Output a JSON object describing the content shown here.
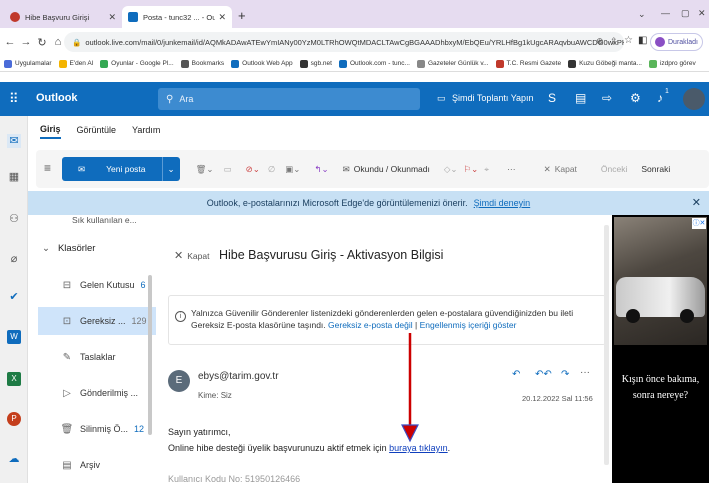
{
  "browser": {
    "tabs": [
      {
        "title": "Hibe Başvuru Girişi",
        "active": false,
        "favicon_color": "#c0392b"
      },
      {
        "title": "Posta - tunc32 ... - Outlook",
        "active": true,
        "favicon_color": "#0f6cbd"
      }
    ],
    "new_tab": "+",
    "window_controls": [
      "⌄",
      "—",
      "▢",
      "✕"
    ],
    "url": "outlook.live.com/mail/0/junkemail/id/AQMkADAwATEwYmIANy00YzM0LTRhOWQtMDACLTAwCgBGAAADhbxyM/EbQEu/YRLHfBg1kUgcARAqvbuAWCDG0wxPHO56hjAAAAgEi...",
    "profile_label": "Durakladı",
    "bookmarks": [
      {
        "label": "Uygulamalar",
        "color": "#4a6bd8"
      },
      {
        "label": "E'den Al",
        "color": "#f4b400"
      },
      {
        "label": "Oyunlar - Google Pl...",
        "color": "#34a853"
      },
      {
        "label": "Bookmarks",
        "color": "#555555"
      },
      {
        "label": "Outlook Web App",
        "color": "#0f6cbd"
      },
      {
        "label": "sgb.net",
        "color": "#333333"
      },
      {
        "label": "Outlook.com - tunc...",
        "color": "#0f6cbd"
      },
      {
        "label": "Gazeteler Günlük v...",
        "color": "#888888"
      },
      {
        "label": "T.C. Resmi Gazete",
        "color": "#c0392b"
      },
      {
        "label": "Kuzu Göbeği manta...",
        "color": "#333333"
      },
      {
        "label": "izdpro görev",
        "color": "#5ab55a"
      }
    ]
  },
  "outlook": {
    "app_name": "Outlook",
    "search_placeholder": "Ara",
    "meet_now": "Şimdi Toplantı Yapın",
    "notification_count": "1",
    "menu_tabs": [
      "Giriş",
      "Görüntüle",
      "Yardım"
    ],
    "ribbon": {
      "new_mail": "Yeni posta",
      "read_unread": "Okundu / Okunmadı",
      "more": "···",
      "close": "Kapat",
      "previous": "Önceki",
      "next": "Sonraki"
    },
    "banner": {
      "text": "Outlook, e-postalarınızı Microsoft Edge'de görüntülemenizi önerir.",
      "link": "Şimdi deneyin"
    },
    "folders": {
      "truncated_top": "Sık kullanılan e...",
      "section": "Klasörler",
      "items": [
        {
          "label": "Gelen Kutusu",
          "count": "6",
          "icon": "inbox-icon"
        },
        {
          "label": "Gereksiz ...",
          "count": "129",
          "icon": "junk-icon",
          "selected": true
        },
        {
          "label": "Taslaklar",
          "count": "",
          "icon": "drafts-icon"
        },
        {
          "label": "Gönderilmiş ...",
          "count": "",
          "icon": "sent-icon"
        },
        {
          "label": "Silinmiş Ö...",
          "count": "12",
          "icon": "deleted-icon"
        },
        {
          "label": "Arşiv",
          "count": "",
          "icon": "archive-icon"
        }
      ]
    },
    "message": {
      "close_label": "Kapat",
      "subject": "Hibe Başvurusu Giriş - Aktivasyon Bilgisi",
      "junk_notice": "Yalnızca Güvenilir Gönderenler listenizdeki gönderenlerden gelen e-postalara güvendiğinizden bu ileti Gereksiz E-posta klasörüne taşındı.",
      "not_junk_link": "Gereksiz e-posta değil",
      "show_content_link": "Engellenmiş içeriği göster",
      "sender_initial": "E",
      "sender": "ebys@tarim.gov.tr",
      "to_label": "Kime:",
      "to_value": "Siz",
      "date": "20.12.2022 Sal 11:56",
      "greeting": "Sayın yatırımcı,",
      "body_text": "Online hibe desteği üyelik başvurunuzu aktif etmek için",
      "body_link": "buraya tıklayın",
      "body_end": ".",
      "next_line": "Kullanıcı Kodu No: 51950126466"
    },
    "ad": {
      "caption_line1": "Kışın önce bakıma,",
      "caption_line2": "sonra nereye?"
    }
  },
  "colors": {
    "brand": "#0f6cbd",
    "annotation_arrow": "#cc0000"
  }
}
